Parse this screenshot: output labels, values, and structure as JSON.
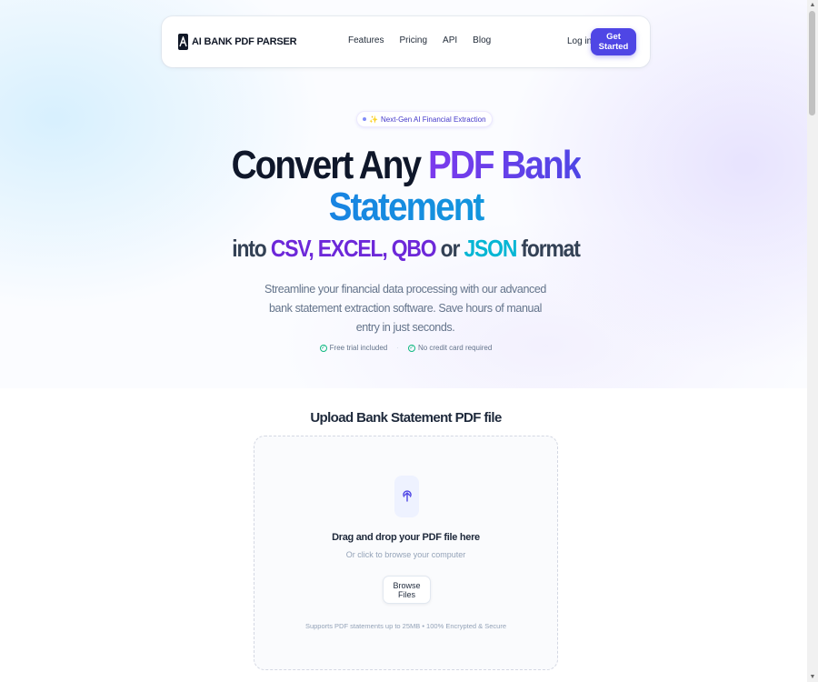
{
  "nav": {
    "brand": "AI BANK PDF PARSER",
    "links": [
      "Features",
      "Pricing",
      "API",
      "Blog"
    ],
    "login": "Log in",
    "cta": "Get Started"
  },
  "hero": {
    "badge": "Next-Gen AI Financial Extraction",
    "title_part1": "Convert Any ",
    "title_part2": "PDF Bank",
    "title_line2": "Statement",
    "format_into": "into ",
    "format_csv": "CSV,",
    "format_excel": " EXCEL,",
    "format_qbo": " QBO",
    "format_or": " or ",
    "format_json": "JSON",
    "format_suffix": " format",
    "subtitle": "Streamline your financial data processing with our advanced bank statement extraction software. Save hours of manual entry in just seconds.",
    "trust": [
      "Free trial included",
      "No credit card required"
    ],
    "trust_separator": "·"
  },
  "upload": {
    "title": "Upload Bank Statement PDF file",
    "drop_title": "Drag and drop your PDF file here",
    "drop_sub": "Or click to browse your computer",
    "browse": "Browse Files",
    "footer": "Supports PDF statements up to 25MB  •  100% Encrypted & Secure"
  },
  "icons": {
    "logo": "logo-mark-icon",
    "upload": "cloud-upload-icon",
    "check": "check-circle-icon",
    "spark": "sparkle-icon"
  },
  "colors": {
    "accent": "#4f46e5",
    "purple": "#7c3aed",
    "teal": "#06b6d4"
  }
}
